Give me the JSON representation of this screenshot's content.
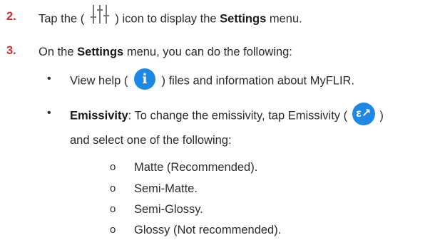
{
  "steps": [
    {
      "number": "2.",
      "text_before": "Tap the (",
      "icon": "sliders-icon",
      "text_middle": ") icon to display the",
      "bold": "Settings",
      "text_after": "menu."
    },
    {
      "number": "3.",
      "text_before": "On the",
      "bold": "Settings",
      "text_after": "menu, you can do the following:"
    }
  ],
  "bullets": {
    "help": {
      "text_before": "View help (",
      "icon": "info-icon",
      "icon_glyph": "i",
      "text_after": ") files and information about MyFLIR."
    },
    "emissivity": {
      "bold": "Emissivity",
      "text_before": ": To change the emissivity, tap Emissivity (",
      "icon": "emissivity-icon",
      "icon_glyph": "ε↗",
      "text_after": ")",
      "line2": "and select one of the following:"
    }
  },
  "bullet_symbol": "•",
  "sub_symbol": "o",
  "options": [
    "Matte (Recommended).",
    "Semi-Matte.",
    "Semi-Glossy.",
    "Glossy (Not recommended)."
  ],
  "colors": {
    "step_number": "#d9262d",
    "icon_blue": "#1e88e5",
    "text": "#2b2b2b"
  }
}
